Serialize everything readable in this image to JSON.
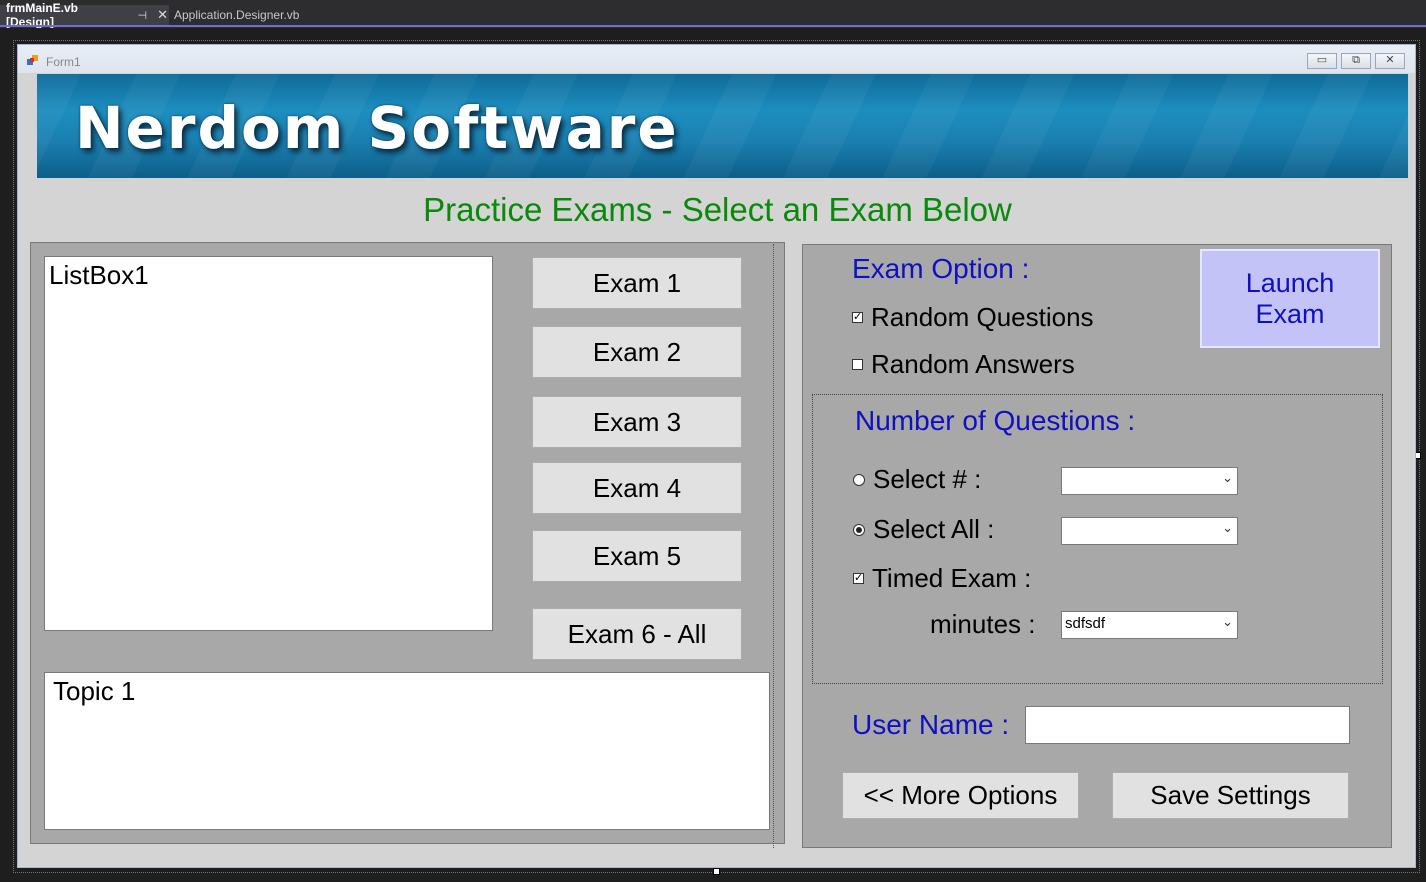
{
  "tabs": {
    "active": "frmMainE.vb [Design]",
    "active_pin": "⊣",
    "active_close": "✕",
    "inactive": "Application.Designer.vb"
  },
  "form": {
    "title": "Form1",
    "banner_text": "Nerdom Software",
    "headline": "Practice Exams - Select an Exam Below",
    "window_buttons": {
      "minimize": "▭",
      "restore": "⧉",
      "close": "✕"
    }
  },
  "left": {
    "listbox_text": "ListBox1",
    "topic_text": "Topic 1",
    "exam_buttons": [
      "Exam 1",
      "Exam 2",
      "Exam 3",
      "Exam 4",
      "Exam 5",
      "Exam 6 - All"
    ]
  },
  "right": {
    "exam_option_label": "Exam Option :",
    "random_questions": {
      "label": "Random Questions",
      "checked": true
    },
    "random_answers": {
      "label": "Random Answers",
      "checked": false
    },
    "launch_button": "Launch Exam",
    "number_of_questions_label": "Number of Questions :",
    "select_number": {
      "label": "Select # :",
      "selected": false,
      "value": ""
    },
    "select_all": {
      "label": "Select All :",
      "selected": true,
      "value": ""
    },
    "timed_exam": {
      "label": "Timed Exam :",
      "checked": true
    },
    "minutes": {
      "label": "minutes :",
      "value": "sdfsdf"
    },
    "user_name_label": "User Name :",
    "user_name_value": "",
    "more_options_button": "<< More Options",
    "save_settings_button": "Save Settings"
  },
  "colors": {
    "headline": "#0a8a0a",
    "blue_labels": "#1010c0",
    "launch_bg": "#c3c3f8",
    "panel_bg": "#a8a8a8",
    "form_bg": "#d4d4d4"
  }
}
